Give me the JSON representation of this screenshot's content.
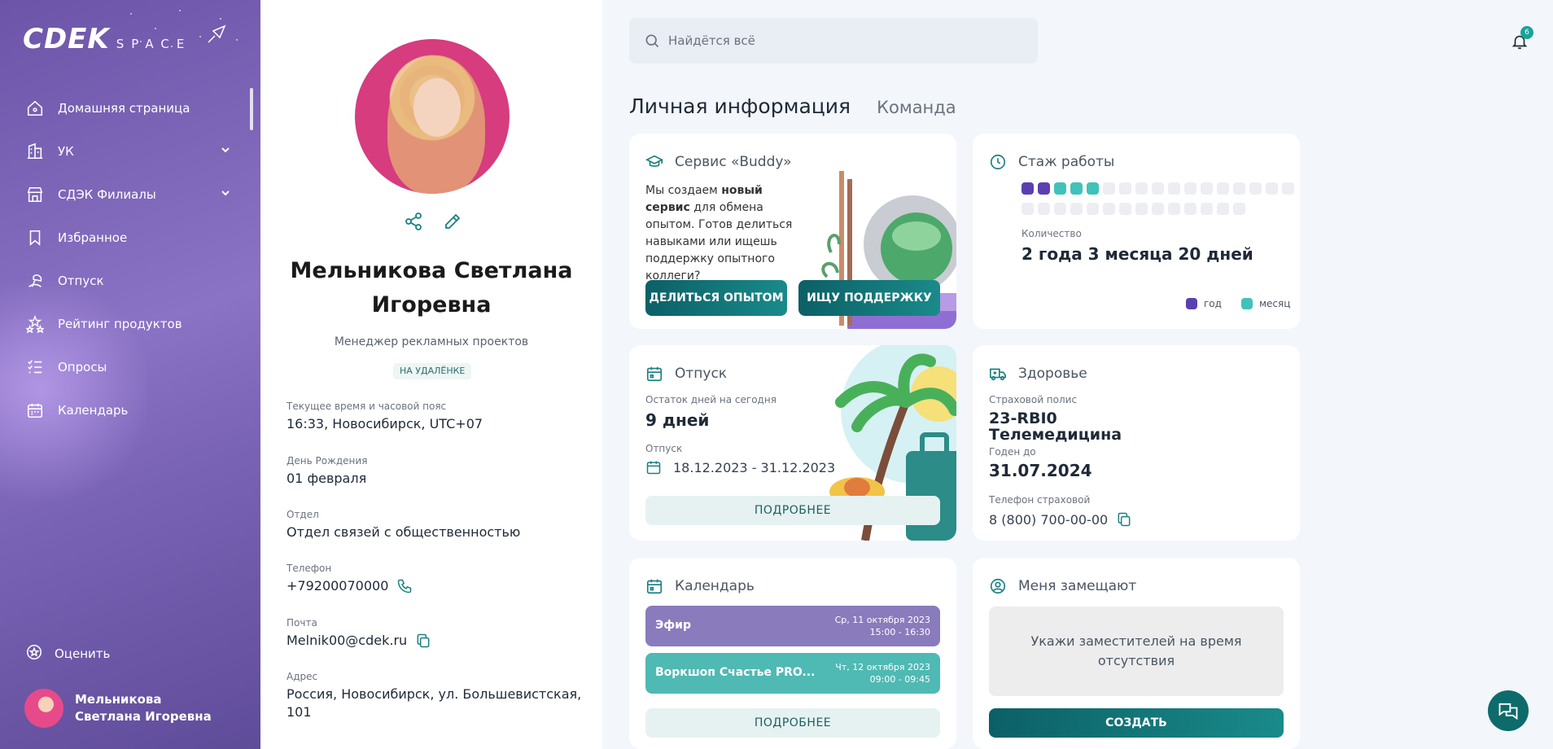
{
  "sidebar": {
    "logo_main": "CDEK",
    "logo_sub": "SPACE",
    "items": [
      {
        "label": "Домашняя страница",
        "icon": "home-icon"
      },
      {
        "label": "УК",
        "icon": "building-icon"
      },
      {
        "label": "СДЭК Филиалы",
        "icon": "store-icon"
      },
      {
        "label": "Избранное",
        "icon": "bookmark-icon"
      },
      {
        "label": "Отпуск",
        "icon": "vacation-icon"
      },
      {
        "label": "Рейтинг продуктов",
        "icon": "stars-icon"
      },
      {
        "label": "Опросы",
        "icon": "list-icon"
      },
      {
        "label": "Календарь",
        "icon": "calendar-icon"
      }
    ],
    "rate_label": "Оценить",
    "user_name": "Мельникова Светлана Игоревна"
  },
  "profile": {
    "full_name": "Мельникова Светлана Игоревна",
    "position": "Менеджер рекламных проектов",
    "status_badge": "НА УДАЛЁНКЕ",
    "fields": {
      "time_label": "Текущее время и часовой пояс",
      "time_value": "16:33, Новосибирск, UTC+07",
      "birthday_label": "День Рождения",
      "birthday_value": "01 февраля",
      "department_label": "Отдел",
      "department_value": "Отдел связей с общественностью",
      "phone_label": "Телефон",
      "phone_value": "+79200070000",
      "email_label": "Почта",
      "email_value": "Melnik00@cdek.ru",
      "address_label": "Адрес",
      "address_value": "Россия, Новосибирск, ул. Большевистская, 101"
    }
  },
  "header": {
    "search_placeholder": "Найдётся всё",
    "notifications_count": "6"
  },
  "tabs": {
    "personal": "Личная информация",
    "team": "Команда"
  },
  "buddy": {
    "title": "Сервис «Buddy»",
    "text_before": "Мы создаем ",
    "text_bold": "новый сервис",
    "text_after": " для обмена опытом. Готов делиться навыками или ищешь поддержку опытного коллеги?",
    "share_button": "ДЕЛИТЬСЯ ОПЫТОМ",
    "support_button": "ИЩУ ПОДДЕРЖКУ"
  },
  "tenure": {
    "title": "Стаж работы",
    "years_filled": 2,
    "months_filled": 3,
    "total_cells": 31,
    "count_label": "Количество",
    "count_value": "2 года 3 месяца 20 дней",
    "legend_year": "год",
    "legend_month": "месяц",
    "year_color": "#5b3fb0",
    "month_color": "#40c2bb"
  },
  "vacation": {
    "title": "Отпуск",
    "remaining_label": "Остаток дней на сегодня",
    "remaining_value": "9 дней",
    "period_label": "Отпуск",
    "period_value": "18.12.2023 - 31.12.2023",
    "more_button": "ПОДРОБНЕЕ"
  },
  "health": {
    "title": "Здоровье",
    "policy_label": "Страховой полис",
    "policy_value": "23-RBI0 Телемедицина",
    "valid_label": "Годен до",
    "valid_value": "31.07.2024",
    "insurer_phone_label": "Телефон страховой",
    "insurer_phone_value": "8 (800) 700-00-00"
  },
  "calendar": {
    "title": "Календарь",
    "events": [
      {
        "title": "Эфир",
        "date": "Ср, 11 октября 2023",
        "time": "15:00 - 16:30",
        "color": "#8a7bbd"
      },
      {
        "title": "Воркшоп Счастье PRO...",
        "date": "Чт, 12 октября 2023",
        "time": "09:00 - 09:45",
        "color": "#4fb9b4"
      }
    ],
    "more_button": "ПОДРОБНЕЕ"
  },
  "substitutes": {
    "title": "Меня замещают",
    "placeholder_text": "Укажи заместителей на время отсутствия",
    "create_button": "СОЗДАТЬ"
  }
}
